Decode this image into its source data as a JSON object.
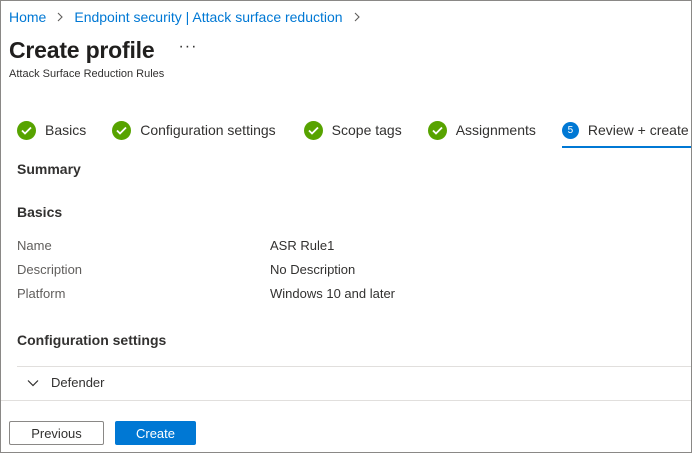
{
  "breadcrumb": {
    "items": [
      "Home",
      "Endpoint security | Attack surface reduction"
    ]
  },
  "header": {
    "title": "Create profile",
    "more": "···",
    "subtitle": "Attack Surface Reduction Rules"
  },
  "wizard": {
    "steps": [
      {
        "label": "Basics",
        "state": "complete"
      },
      {
        "label": "Configuration settings",
        "state": "complete"
      },
      {
        "label": "Scope tags",
        "state": "complete"
      },
      {
        "label": "Assignments",
        "state": "complete"
      },
      {
        "label": "Review + create",
        "state": "active",
        "number": "5"
      }
    ]
  },
  "summary": {
    "heading": "Summary",
    "basics_heading": "Basics",
    "fields": [
      {
        "label": "Name",
        "value": "ASR Rule1"
      },
      {
        "label": "Description",
        "value": "No Description"
      },
      {
        "label": "Platform",
        "value": "Windows 10 and later"
      }
    ],
    "config_heading": "Configuration settings",
    "accordion_label": "Defender"
  },
  "footer": {
    "previous_label": "Previous",
    "create_label": "Create"
  },
  "colors": {
    "accent": "#0078d4",
    "success": "#57a300"
  }
}
